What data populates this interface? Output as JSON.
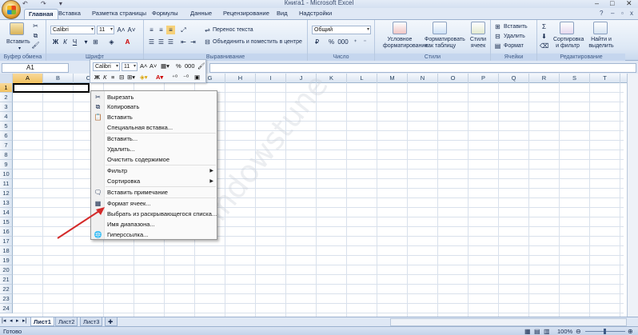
{
  "window": {
    "title": "Книга1 - Microsoft Excel"
  },
  "ribbon_tabs": [
    "Главная",
    "Вставка",
    "Разметка страницы",
    "Формулы",
    "Данные",
    "Рецензирование",
    "Вид",
    "Надстройки"
  ],
  "active_tab": "Главная",
  "groups": {
    "clipboard": {
      "label": "Буфер обмена",
      "paste": "Вставить"
    },
    "font": {
      "label": "Шрифт",
      "font_name": "Calibri",
      "font_size": "11",
      "bold": "Ж",
      "italic": "К",
      "underline": "Ч"
    },
    "alignment": {
      "label": "Выравнивание",
      "wrap": "Перенос текста",
      "merge": "Объединить и поместить в центре"
    },
    "number": {
      "label": "Число",
      "format": "Общий",
      "percent": "%",
      "thousands": "000"
    },
    "styles": {
      "label": "Стили",
      "conditional": [
        "Условное",
        "форматирование"
      ],
      "table": [
        "Форматировать",
        "как таблицу"
      ],
      "cell_styles": [
        "Стили",
        "ячеек"
      ]
    },
    "cells": {
      "label": "Ячейки",
      "insert": "Вставить",
      "delete": "Удалить",
      "format": "Формат"
    },
    "editing": {
      "label": "Редактирование",
      "sort": [
        "Сортировка",
        "и фильтр"
      ],
      "find": [
        "Найти и",
        "выделить"
      ]
    }
  },
  "formula_bar": {
    "name_box": "A1",
    "fx": "fx"
  },
  "columns": [
    "A",
    "B",
    "C",
    "D",
    "E",
    "F",
    "G",
    "H",
    "I",
    "J",
    "K",
    "L",
    "M",
    "N",
    "O",
    "P",
    "Q",
    "R",
    "S",
    "T",
    "U"
  ],
  "rows": [
    "1",
    "2",
    "3",
    "4",
    "5",
    "6",
    "7",
    "8",
    "9",
    "10",
    "11",
    "12",
    "13",
    "14",
    "15",
    "16",
    "17",
    "18",
    "19",
    "20",
    "21",
    "22",
    "23",
    "24"
  ],
  "mini_toolbar": {
    "font": "Calibri",
    "size": "11",
    "bold": "Ж",
    "italic": "К",
    "percent": "%",
    "thousands": "000"
  },
  "context_menu": [
    {
      "label": "Вырезать",
      "icon": "scissors-icon"
    },
    {
      "label": "Копировать",
      "icon": "copy-icon"
    },
    {
      "label": "Вставить",
      "icon": "paste-icon"
    },
    {
      "label": "Специальная вставка..."
    },
    {
      "label": "Вставить..."
    },
    {
      "label": "Удалить..."
    },
    {
      "label": "Очистить содержимое"
    },
    {
      "label": "Фильтр",
      "submenu": true
    },
    {
      "label": "Сортировка",
      "submenu": true
    },
    {
      "label": "Вставить примечание",
      "icon": "comment-icon"
    },
    {
      "label": "Формат ячеек...",
      "icon": "format-cells-icon"
    },
    {
      "label": "Выбрать из раскрывающегося списка..."
    },
    {
      "label": "Имя диапазона..."
    },
    {
      "label": "Гиперссылка...",
      "icon": "hyperlink-icon"
    }
  ],
  "sheets": [
    "Лист1",
    "Лист2",
    "Лист3"
  ],
  "active_sheet": "Лист1",
  "status": {
    "text": "Готово",
    "zoom": "100%"
  },
  "watermark": "windowstune",
  "colors": {
    "accent": "#dfe8f5",
    "arrow": "#d42a2a"
  }
}
